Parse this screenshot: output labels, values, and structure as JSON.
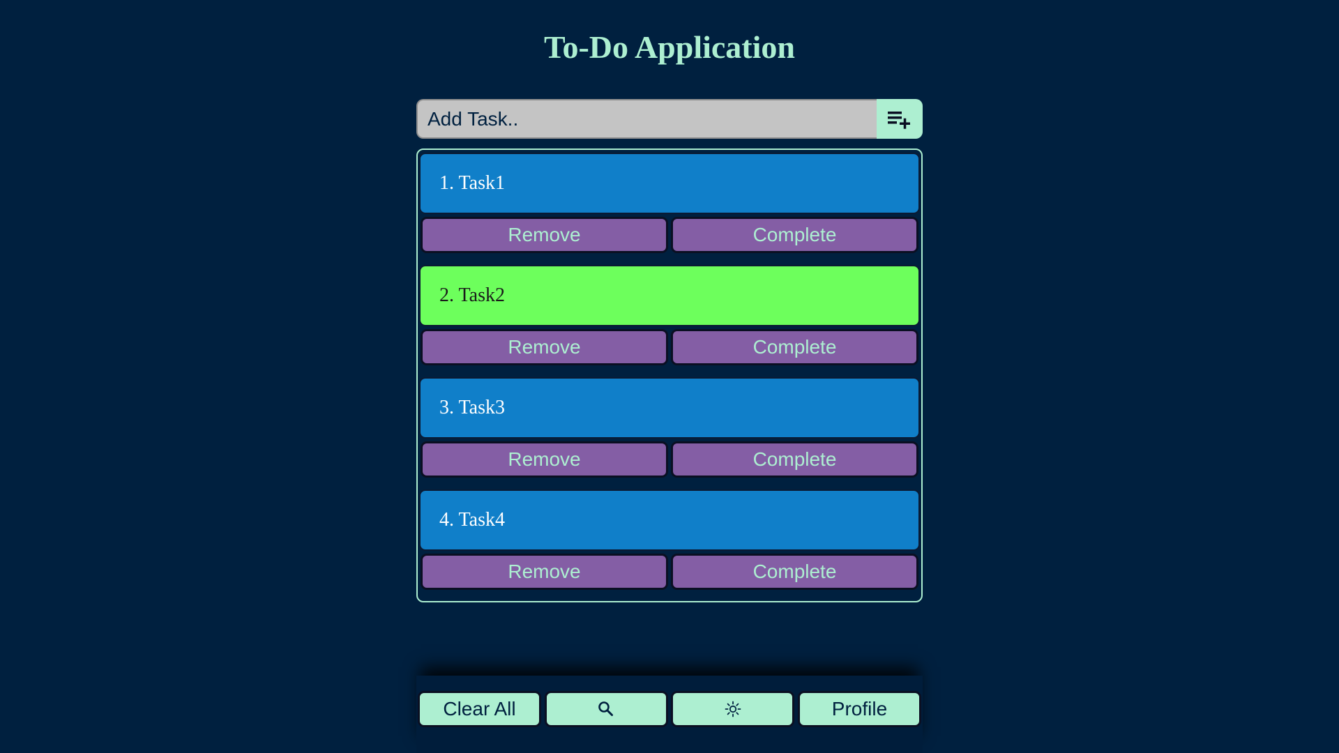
{
  "header": {
    "title": "To-Do Application"
  },
  "add_task": {
    "placeholder": "Add Task..",
    "value": "",
    "button_icon": "playlist-add-icon"
  },
  "tasks": [
    {
      "label": "1. Task1",
      "color": "#107fc9",
      "style": "blue"
    },
    {
      "label": "2. Task2",
      "color": "#6dff5c",
      "style": "green"
    },
    {
      "label": "3. Task3",
      "color": "#107fc9",
      "style": "blue"
    },
    {
      "label": "4. Task4",
      "color": "#107fc9",
      "style": "blue"
    }
  ],
  "task_actions": {
    "remove_label": "Remove",
    "complete_label": "Complete"
  },
  "bottom_bar": {
    "clear_all_label": "Clear All",
    "search_icon": "search-icon",
    "theme_icon": "sun-icon",
    "profile_label": "Profile"
  },
  "colors": {
    "background": "#00203f",
    "accent": "#adefd1",
    "button_purple": "#845ea5",
    "input_gray": "#c4c4c4"
  }
}
